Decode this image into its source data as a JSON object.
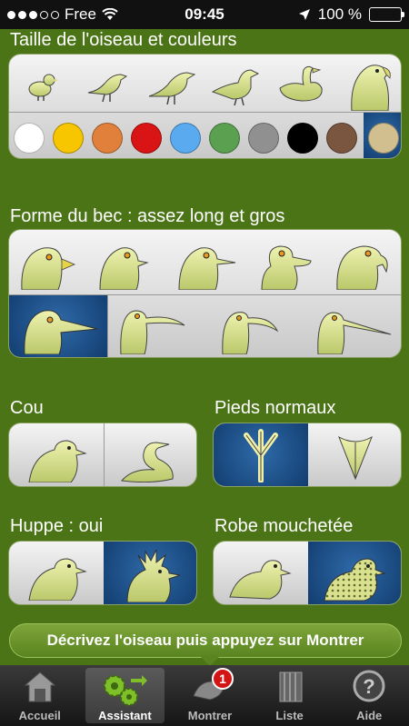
{
  "status": {
    "carrier": "Free",
    "time": "09:45",
    "battery": "100 %"
  },
  "sections": {
    "size_colors": {
      "title": "Taille de l'oiseau et couleurs"
    },
    "beak": {
      "title": "Forme du bec : assez long et gros"
    },
    "neck": {
      "title": "Cou"
    },
    "feet": {
      "title": "Pieds normaux"
    },
    "crest": {
      "title": "Huppe : oui"
    },
    "plumage": {
      "title": "Robe mouchetée"
    }
  },
  "colors": [
    "#ffffff",
    "#f7c600",
    "#e0803a",
    "#d81414",
    "#5aaaf0",
    "#5aa050",
    "#909090",
    "#000000",
    "#7a5540",
    "#d2bf8f"
  ],
  "selected_color_index": 9,
  "hint": "Décrivez l'oiseau puis appuyez sur Montrer",
  "tabs": [
    {
      "label": "Accueil",
      "icon": "house-icon"
    },
    {
      "label": "Assistant",
      "icon": "gears-icon"
    },
    {
      "label": "Montrer",
      "icon": "bird-icon",
      "badge": "1"
    },
    {
      "label": "Liste",
      "icon": "book-icon"
    },
    {
      "label": "Aide",
      "icon": "help-icon"
    }
  ],
  "active_tab": 1,
  "accent": "#4b7417"
}
